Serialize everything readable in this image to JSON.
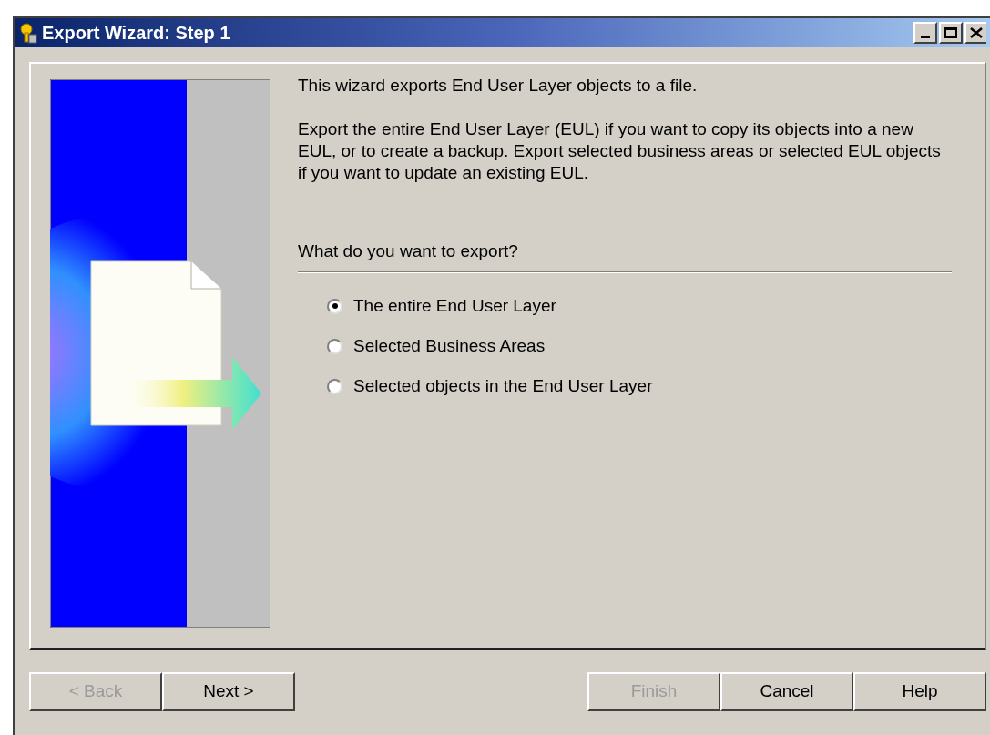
{
  "window": {
    "title": "Export Wizard: Step 1"
  },
  "intro": "This wizard exports End User Layer objects to a file.",
  "description": "Export the entire End User Layer (EUL) if you want to copy its objects into a new EUL, or to create a backup. Export selected business areas or selected EUL objects if you want to update an existing EUL.",
  "question": "What do you want to export?",
  "options": [
    {
      "label": "The entire End User Layer",
      "selected": true
    },
    {
      "label": "Selected Business Areas",
      "selected": false
    },
    {
      "label": "Selected objects in the End User Layer",
      "selected": false
    }
  ],
  "buttons": [
    {
      "label": "< Back",
      "disabled": true
    },
    {
      "label": "Next >",
      "disabled": false
    },
    {
      "label": "Finish",
      "disabled": true
    },
    {
      "label": "Cancel",
      "disabled": false
    },
    {
      "label": "Help",
      "disabled": false
    }
  ]
}
